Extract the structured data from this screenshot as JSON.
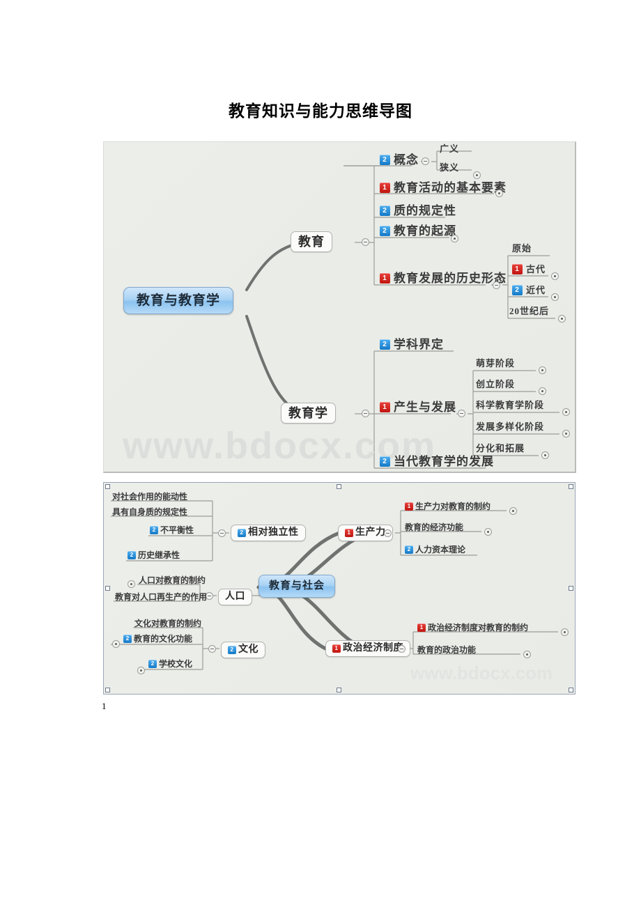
{
  "document": {
    "title": "教育知识与能力思维导图",
    "page_number": "1",
    "watermark": "www.bdocx.com",
    "watermark_small": "www.bdocx.com"
  },
  "colors": {
    "flag_red": "#c01610",
    "flag_blue": "#1479c6",
    "root_blue": "#8cc3f0",
    "canvas": "#eceeea",
    "watermark": "#dcdedb"
  },
  "mindmap1": {
    "root": "教育与教育学",
    "branch_education": {
      "label": "教育",
      "children": [
        {
          "flag": "2",
          "label": "概念",
          "children": [
            "广义",
            "狭义"
          ]
        },
        {
          "flag": "1",
          "label": "教育活动的基本要素",
          "children": []
        },
        {
          "flag": "2",
          "label": "质的规定性",
          "children": []
        },
        {
          "flag": "2",
          "label": "教育的起源",
          "children": []
        },
        {
          "flag": "1",
          "label": "教育发展的历史形态",
          "children_flagged": [
            {
              "flag": "",
              "label": "原始"
            },
            {
              "flag": "1",
              "label": "古代"
            },
            {
              "flag": "2",
              "label": "近代"
            },
            {
              "flag": "",
              "label": "20世纪后"
            }
          ]
        }
      ]
    },
    "branch_pedagogy": {
      "label": "教育学",
      "children": [
        {
          "flag": "2",
          "label": "学科界定",
          "children": []
        },
        {
          "flag": "1",
          "label": "产生与发展",
          "children": [
            "萌芽阶段",
            "创立阶段",
            "科学教育学阶段",
            "发展多样化阶段",
            "分化和拓展"
          ]
        },
        {
          "flag": "2",
          "label": "当代教育学的发展",
          "children": []
        }
      ]
    }
  },
  "mindmap2": {
    "root": "教育与社会",
    "branch_independence": {
      "flag": "2",
      "label": "相对独立性",
      "children": [
        {
          "flag": "",
          "label": "对社会作用的能动性"
        },
        {
          "flag": "",
          "label": "具有自身质的规定性"
        },
        {
          "flag": "2",
          "label": "不平衡性"
        },
        {
          "flag": "2",
          "label": "历史继承性"
        }
      ]
    },
    "branch_population": {
      "flag": "",
      "label": "人口",
      "children": [
        {
          "flag": "",
          "label": "人口对教育的制约"
        },
        {
          "flag": "",
          "label": "教育对人口再生产的作用"
        }
      ]
    },
    "branch_culture": {
      "flag": "2",
      "label": "文化",
      "children": [
        {
          "flag": "",
          "label": "文化对教育的制约"
        },
        {
          "flag": "2",
          "label": "教育的文化功能"
        },
        {
          "flag": "2",
          "label": "学校文化"
        }
      ]
    },
    "branch_productivity": {
      "flag": "1",
      "label": "生产力",
      "children": [
        {
          "flag": "1",
          "label": "生产力对教育的制约"
        },
        {
          "flag": "",
          "label": "教育的经济功能"
        },
        {
          "flag": "2",
          "label": "人力资本理论"
        }
      ]
    },
    "branch_politics": {
      "flag": "1",
      "label": "政治经济制度",
      "children": [
        {
          "flag": "1",
          "label": "政治经济制度对教育的制约"
        },
        {
          "flag": "",
          "label": "教育的政治功能"
        }
      ]
    }
  }
}
